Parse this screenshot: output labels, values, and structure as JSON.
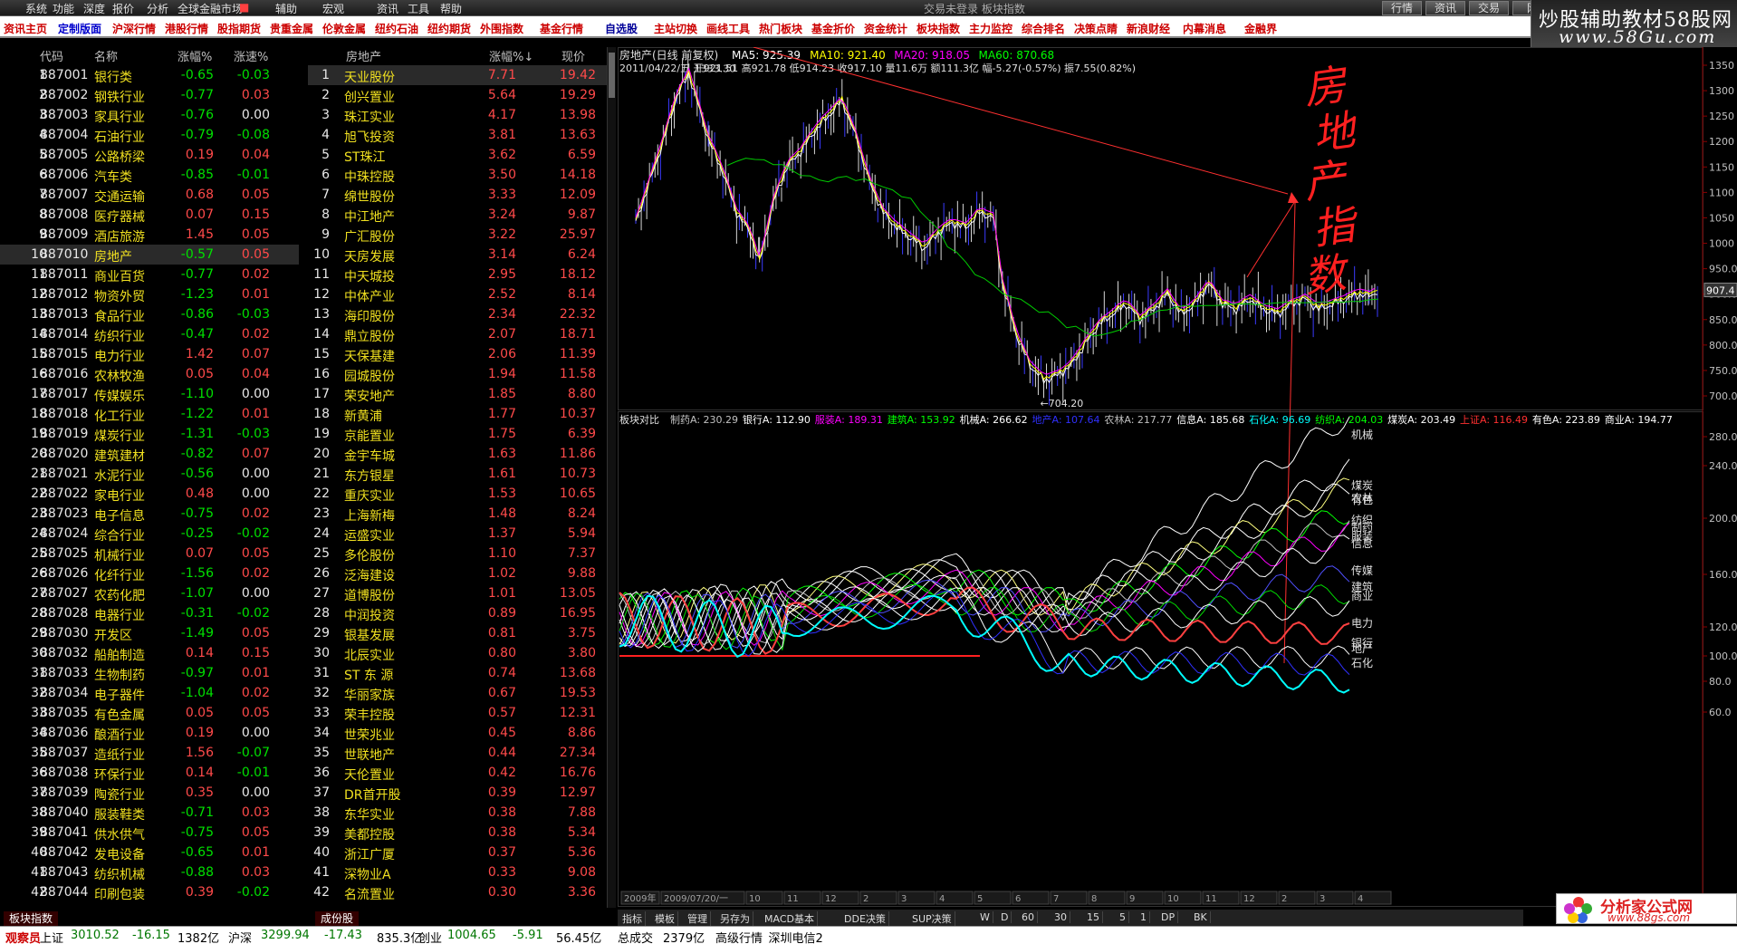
{
  "menu": {
    "items": [
      "系统",
      "功能",
      "深度",
      "报价",
      "分析",
      "全球金融市场",
      "",
      "辅助",
      "宏观",
      "资讯",
      "工具",
      "帮助"
    ],
    "window_title": "交易未登录  板块指数",
    "right_buttons": [
      "行情",
      "资讯",
      "交易",
      "网"
    ]
  },
  "logo": {
    "line1": "炒股辅助教材58股网",
    "line2": "www.58Gu.com"
  },
  "toolbar": {
    "items": [
      "资讯主页",
      "定制版面",
      "沪深行情",
      "港股行情",
      "股指期货",
      "贵重金属",
      "伦敦金属",
      "纽约石油",
      "纽约期货",
      "外围指数",
      "基金行情",
      "自选股",
      "主站切换",
      "画线工具",
      "热门板块",
      "基金折价",
      "资金统计",
      "板块指数",
      "主力监控",
      "综合排名",
      "决策点睛",
      "新浪财经",
      "内幕消息",
      "金融界"
    ]
  },
  "left_table": {
    "headers": [
      "代码",
      "名称",
      "涨幅%",
      "涨速%"
    ],
    "rows": [
      [
        "1",
        "887001",
        "银行类",
        "-0.65",
        "-0.03"
      ],
      [
        "2",
        "887002",
        "钢铁行业",
        "-0.77",
        "0.03"
      ],
      [
        "3",
        "887003",
        "家具行业",
        "-0.76",
        "0.00"
      ],
      [
        "4",
        "887004",
        "石油行业",
        "-0.79",
        "-0.08"
      ],
      [
        "5",
        "887005",
        "公路桥梁",
        "0.19",
        "0.04"
      ],
      [
        "6",
        "887006",
        "汽车类",
        "-0.85",
        "-0.01"
      ],
      [
        "7",
        "887007",
        "交通运输",
        "0.68",
        "0.05"
      ],
      [
        "8",
        "887008",
        "医疗器械",
        "0.07",
        "0.15"
      ],
      [
        "9",
        "887009",
        "酒店旅游",
        "1.45",
        "0.05"
      ],
      [
        "10",
        "887010",
        "房地产",
        "-0.57",
        "0.05"
      ],
      [
        "11",
        "887011",
        "商业百货",
        "-0.77",
        "0.02"
      ],
      [
        "12",
        "887012",
        "物资外贸",
        "-1.23",
        "0.01"
      ],
      [
        "13",
        "887013",
        "食品行业",
        "-0.86",
        "-0.03"
      ],
      [
        "14",
        "887014",
        "纺织行业",
        "-0.47",
        "0.02"
      ],
      [
        "15",
        "887015",
        "电力行业",
        "1.42",
        "0.07"
      ],
      [
        "16",
        "887016",
        "农林牧渔",
        "0.05",
        "0.04"
      ],
      [
        "17",
        "887017",
        "传媒娱乐",
        "-1.10",
        "0.00"
      ],
      [
        "18",
        "887018",
        "化工行业",
        "-1.22",
        "0.01"
      ],
      [
        "19",
        "887019",
        "煤炭行业",
        "-1.31",
        "-0.03"
      ],
      [
        "20",
        "887020",
        "建筑建材",
        "-0.82",
        "0.07"
      ],
      [
        "21",
        "887021",
        "水泥行业",
        "-0.56",
        "0.00"
      ],
      [
        "22",
        "887022",
        "家电行业",
        "0.48",
        "0.00"
      ],
      [
        "23",
        "887023",
        "电子信息",
        "-0.75",
        "0.02"
      ],
      [
        "24",
        "887024",
        "综合行业",
        "-0.25",
        "-0.02"
      ],
      [
        "25",
        "887025",
        "机械行业",
        "0.07",
        "0.05"
      ],
      [
        "26",
        "887026",
        "化纤行业",
        "-1.56",
        "0.02"
      ],
      [
        "27",
        "887027",
        "农药化肥",
        "-1.07",
        "0.00"
      ],
      [
        "28",
        "887028",
        "电器行业",
        "-0.31",
        "-0.02"
      ],
      [
        "29",
        "887030",
        "开发区",
        "-1.49",
        "0.05"
      ],
      [
        "30",
        "887032",
        "船舶制造",
        "0.14",
        "0.15"
      ],
      [
        "31",
        "887033",
        "生物制药",
        "-0.97",
        "0.01"
      ],
      [
        "32",
        "887034",
        "电子器件",
        "-1.04",
        "0.02"
      ],
      [
        "33",
        "887035",
        "有色金属",
        "0.05",
        "0.05"
      ],
      [
        "34",
        "887036",
        "酿酒行业",
        "0.19",
        "0.00"
      ],
      [
        "35",
        "887037",
        "造纸行业",
        "1.56",
        "-0.07"
      ],
      [
        "36",
        "887038",
        "环保行业",
        "0.14",
        "-0.01"
      ],
      [
        "37",
        "887039",
        "陶瓷行业",
        "0.35",
        "0.00"
      ],
      [
        "38",
        "887040",
        "服装鞋类",
        "-0.71",
        "0.03"
      ],
      [
        "39",
        "887041",
        "供水供气",
        "-0.75",
        "0.05"
      ],
      [
        "40",
        "887042",
        "发电设备",
        "-0.65",
        "0.01"
      ],
      [
        "41",
        "887043",
        "纺织机械",
        "-0.88",
        "0.03"
      ],
      [
        "42",
        "887044",
        "印刷包装",
        "0.39",
        "-0.02"
      ]
    ],
    "bottom_tab": "板块指数"
  },
  "mid_table": {
    "headers": [
      "房地产",
      "涨幅%↓",
      "现价"
    ],
    "rows": [
      [
        "1",
        "天业股份",
        "7.71",
        "19.42"
      ],
      [
        "2",
        "创兴置业",
        "5.64",
        "19.29"
      ],
      [
        "3",
        "珠江实业",
        "4.17",
        "13.98"
      ],
      [
        "4",
        "旭飞投资",
        "3.81",
        "13.63"
      ],
      [
        "5",
        "ST珠江",
        "3.62",
        "6.59"
      ],
      [
        "6",
        "中珠控股",
        "3.50",
        "14.18"
      ],
      [
        "7",
        "绵世股份",
        "3.33",
        "12.09"
      ],
      [
        "8",
        "中江地产",
        "3.24",
        "9.87"
      ],
      [
        "9",
        "广汇股份",
        "3.22",
        "25.97"
      ],
      [
        "10",
        "天房发展",
        "3.14",
        "6.24"
      ],
      [
        "11",
        "中天城投",
        "2.95",
        "18.12"
      ],
      [
        "12",
        "中体产业",
        "2.52",
        "8.14"
      ],
      [
        "13",
        "海印股份",
        "2.34",
        "22.32"
      ],
      [
        "14",
        "鼎立股份",
        "2.07",
        "18.71"
      ],
      [
        "15",
        "天保基建",
        "2.06",
        "11.39"
      ],
      [
        "16",
        "园城股份",
        "1.94",
        "11.58"
      ],
      [
        "17",
        "荣安地产",
        "1.85",
        "8.80"
      ],
      [
        "18",
        "新黄浦",
        "1.77",
        "10.37"
      ],
      [
        "19",
        "京能置业",
        "1.75",
        "6.39"
      ],
      [
        "20",
        "金宇车城",
        "1.63",
        "11.86"
      ],
      [
        "21",
        "东方银星",
        "1.61",
        "10.73"
      ],
      [
        "22",
        "重庆实业",
        "1.53",
        "10.65"
      ],
      [
        "23",
        "上海新梅",
        "1.48",
        "8.24"
      ],
      [
        "24",
        "运盛实业",
        "1.37",
        "5.94"
      ],
      [
        "25",
        "多伦股份",
        "1.10",
        "7.37"
      ],
      [
        "26",
        "泛海建设",
        "1.02",
        "9.88"
      ],
      [
        "27",
        "道博股份",
        "1.01",
        "13.05"
      ],
      [
        "28",
        "中润投资",
        "0.89",
        "16.95"
      ],
      [
        "29",
        "银基发展",
        "0.81",
        "3.75"
      ],
      [
        "30",
        "北辰实业",
        "0.80",
        "3.80"
      ],
      [
        "31",
        "ST 东 源",
        "0.74",
        "13.68"
      ],
      [
        "32",
        "华丽家族",
        "0.67",
        "19.53"
      ],
      [
        "33",
        "荣丰控股",
        "0.57",
        "12.31"
      ],
      [
        "34",
        "世荣兆业",
        "0.45",
        "8.86"
      ],
      [
        "35",
        "世联地产",
        "0.44",
        "27.34"
      ],
      [
        "36",
        "天伦置业",
        "0.42",
        "16.76"
      ],
      [
        "37",
        "DR首开股",
        "0.39",
        "12.97"
      ],
      [
        "38",
        "东华实业",
        "0.38",
        "7.88"
      ],
      [
        "39",
        "美都控股",
        "0.38",
        "5.34"
      ],
      [
        "40",
        "浙江广厦",
        "0.37",
        "5.36"
      ],
      [
        "41",
        "深物业A",
        "0.33",
        "9.08"
      ],
      [
        "42",
        "名流置业",
        "0.30",
        "3.36"
      ]
    ],
    "bottom_tab": "成份股"
  },
  "upper_chart": {
    "title": "房地产(日线 前复权)",
    "ma": [
      {
        "label": "MA5: 925.39",
        "color": "#ffffff"
      },
      {
        "label": "MA10: 921.40",
        "color": "#ffff00"
      },
      {
        "label": "MA20: 918.05",
        "color": "#ff00ff"
      },
      {
        "label": "MA60: 870.68",
        "color": "#00ff00"
      }
    ],
    "info": "2011/04/22/五 开921.51 高921.78 低914.23 收917.10 量11.6万 额111.3亿 幅-5.27(-0.57%) 振7.55(0.82%)",
    "high_label": "1333.30",
    "low_label": "←704.20",
    "current_price": "907.4",
    "y_ticks": [
      "1350",
      "1300",
      "1250",
      "1200",
      "1150",
      "1100",
      "1050",
      "1000",
      "950.0",
      "900.0",
      "850.0",
      "800.0",
      "750.0",
      "700.0"
    ],
    "annotation": "房地产指数"
  },
  "lower_chart": {
    "title": "板块对比",
    "legend": [
      {
        "label": "制药A: 230.29",
        "color": "#c0c0c0"
      },
      {
        "label": "银行A: 112.90",
        "color": "#ffffff"
      },
      {
        "label": "服装A: 189.31",
        "color": "#ff00ff"
      },
      {
        "label": "建筑A: 153.92",
        "color": "#00ff00"
      },
      {
        "label": "机械A: 266.62",
        "color": "#ffffff"
      },
      {
        "label": "地产A: 107.64",
        "color": "#3030ff"
      },
      {
        "label": "农林A: 217.77",
        "color": "#c0c0c0"
      },
      {
        "label": "信息A: 185.68",
        "color": "#ffffff"
      },
      {
        "label": "石化A: 96.69",
        "color": "#00ffff"
      },
      {
        "label": "纺织A: 204.03",
        "color": "#00ff00"
      },
      {
        "label": "煤炭A: 203.49",
        "color": "#ffffff"
      },
      {
        "label": "上证A: 116.49",
        "color": "#ff3030"
      },
      {
        "label": "有色A: 223.89",
        "color": "#ffffff"
      },
      {
        "label": "商业A: 194.77",
        "color": "#ffffff"
      }
    ],
    "series_labels": [
      "机械",
      "煤炭",
      "有色",
      "农林",
      "纺织",
      "制药",
      "服装",
      "信息",
      "传媒",
      "建筑",
      "商业",
      "电力",
      "银行",
      "地产",
      "石化"
    ],
    "y_ticks": [
      "280.0",
      "240.0",
      "200.0",
      "160.0",
      "120.0",
      "100.0",
      "80.0",
      "60.0"
    ],
    "x_labels": [
      "2009年",
      "2009/07/20/一",
      "10",
      "11",
      "12",
      "2",
      "3",
      "4",
      "5",
      "6",
      "7",
      "8",
      "9",
      "10",
      "11",
      "12",
      "2",
      "3",
      "4"
    ]
  },
  "chart_tabs": [
    "指标",
    "模板",
    "管理",
    "另存为",
    "MACD基本",
    "DDE决策",
    "SUP决策",
    "W",
    "D",
    "60",
    "30",
    "15",
    "5",
    "1",
    "DP",
    "BK"
  ],
  "status": [
    {
      "text": "观察员",
      "color": "#cc0000"
    },
    {
      "text": "上证",
      "color": "#000000"
    },
    {
      "text": "3010.52",
      "color": "#007700"
    },
    {
      "text": "-16.15",
      "color": "#007700"
    },
    {
      "text": "1382亿",
      "color": "#000000"
    },
    {
      "text": "沪深",
      "color": "#000000"
    },
    {
      "text": "3299.94",
      "color": "#007700"
    },
    {
      "text": "-17.43",
      "color": "#007700"
    },
    {
      "text": "835.3亿",
      "color": "#000000"
    },
    {
      "text": "创业",
      "color": "#000000"
    },
    {
      "text": "1004.65",
      "color": "#007700"
    },
    {
      "text": "-5.91",
      "color": "#007700"
    },
    {
      "text": "56.45亿",
      "color": "#000000"
    },
    {
      "text": "总成交",
      "color": "#000000"
    },
    {
      "text": "2379亿",
      "color": "#000000"
    },
    {
      "text": "高级行情_深圳电信2",
      "color": "#000000"
    }
  ],
  "ad2": {
    "title": "分析家公式网",
    "url": "www.88gs.com"
  }
}
